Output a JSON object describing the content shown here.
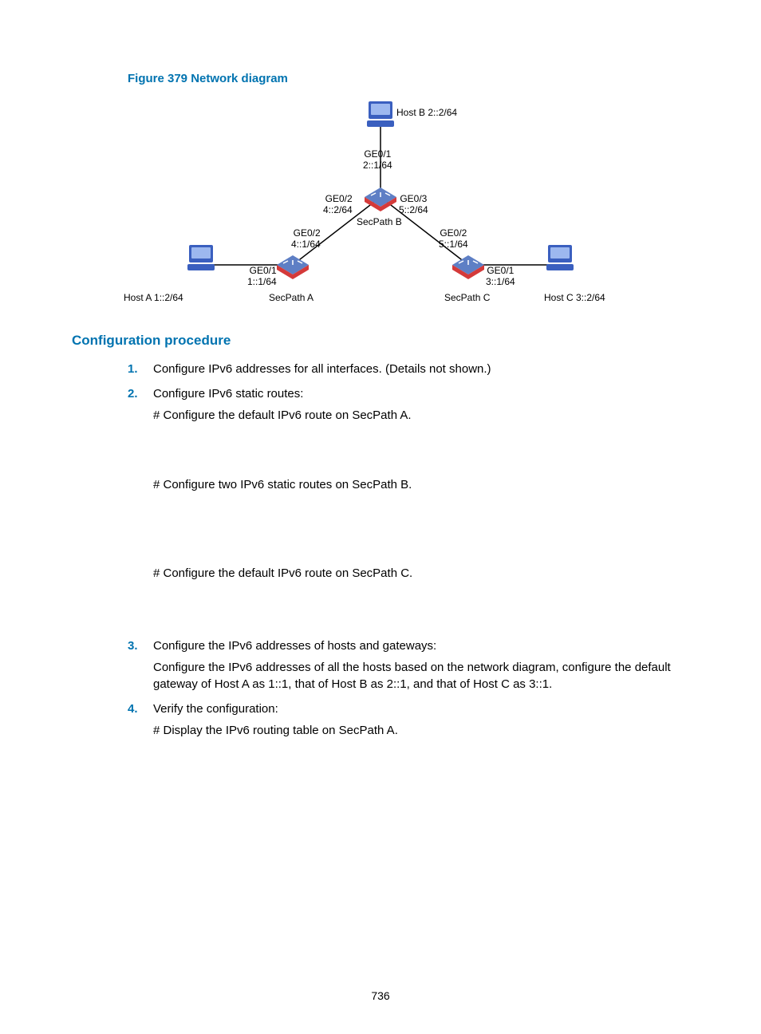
{
  "figure": {
    "title": "Figure 379 Network diagram",
    "labels": {
      "hostB": "Host B 2::2/64",
      "hostA": "Host A 1::2/64",
      "hostC": "Host C 3::2/64",
      "secpathA": "SecPath A",
      "secpathB": "SecPath B",
      "secpathC": "SecPath C",
      "ge01_top": "GE0/1\n2::1/64",
      "ge02_bleft": "GE0/2\n4::2/64",
      "ge03_bright": "GE0/3\n5::2/64",
      "ge02_aright": "GE0/2\n4::1/64",
      "ge02_cleft": "GE0/2\n5::1/64",
      "ge01_a": "GE0/1\n1::1/64",
      "ge01_c": "GE0/1\n3::1/64"
    }
  },
  "section_title": "Configuration procedure",
  "steps": {
    "s1": {
      "num": "1.",
      "text": "Configure IPv6 addresses for all interfaces. (Details not shown.)"
    },
    "s2": {
      "num": "2.",
      "text": "Configure IPv6 static routes:",
      "sub1": "# Configure the default IPv6 route on SecPath A.",
      "sub2": "# Configure two IPv6 static routes on SecPath B.",
      "sub3": "# Configure the default IPv6 route on SecPath C."
    },
    "s3": {
      "num": "3.",
      "text": "Configure the IPv6 addresses of hosts and gateways:",
      "sub1": "Configure the IPv6 addresses of all the hosts based on the network diagram, configure the default gateway of Host A as 1::1, that of Host B as 2::1, and that of Host C as 3::1."
    },
    "s4": {
      "num": "4.",
      "text": "Verify the configuration:",
      "sub1": "# Display the IPv6 routing table on SecPath A."
    }
  },
  "page_number": "736"
}
